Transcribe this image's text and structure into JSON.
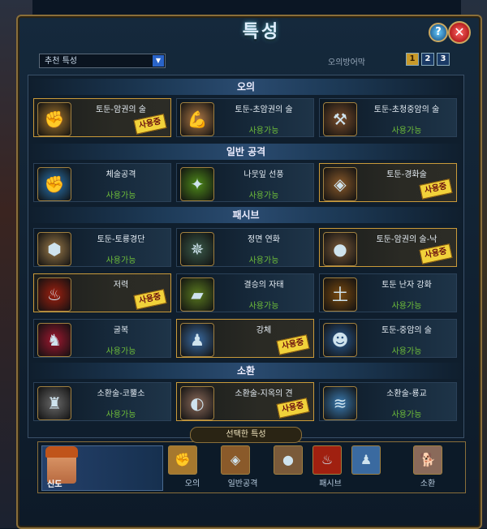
{
  "window": {
    "title": "특성"
  },
  "controls": {
    "help": "?",
    "close": "✕"
  },
  "dropdown": {
    "value": "추천 특성"
  },
  "mode_label": "오의방어막",
  "pages": [
    "1",
    "2",
    "3"
  ],
  "sections": {
    "oui": "오의",
    "general": "일반 공격",
    "passive": "패시브",
    "summon": "소환"
  },
  "cards": [
    {
      "name": "토둔-암권의 술",
      "status": "",
      "stamp": "사용중",
      "icon": "fist-icon",
      "color": "#a6782e"
    },
    {
      "name": "토둔-초암권의 술",
      "status": "사용가능",
      "stamp": "",
      "icon": "arm-icon",
      "color": "#b07a46"
    },
    {
      "name": "토둔-초청중암의 술",
      "status": "사용가능",
      "stamp": "",
      "icon": "hammer-icon",
      "color": "#7a4e2c"
    },
    {
      "name": "체술공격",
      "status": "사용가능",
      "stamp": "",
      "icon": "punch-icon",
      "color": "#2a7ab8"
    },
    {
      "name": "나뭇잎 선풍",
      "status": "사용가능",
      "stamp": "",
      "icon": "kick-icon",
      "color": "#4e8a1a"
    },
    {
      "name": "토둔-경화술",
      "status": "",
      "stamp": "사용중",
      "icon": "stone-shield-icon",
      "color": "#8a5a2a"
    },
    {
      "name": "토둔-토룡경단",
      "status": "사용가능",
      "stamp": "",
      "icon": "boulder-icon",
      "color": "#9a7a4a"
    },
    {
      "name": "정면 연화",
      "status": "사용가능",
      "stamp": "",
      "icon": "drill-icon",
      "color": "#3a5a4a"
    },
    {
      "name": "토둔-암권의 술-낙",
      "status": "",
      "stamp": "사용중",
      "icon": "rock-fist-icon",
      "color": "#7a5a3a"
    },
    {
      "name": "저력",
      "status": "",
      "stamp": "사용중",
      "icon": "red-aura-icon",
      "color": "#a02010"
    },
    {
      "name": "결승의 자태",
      "status": "사용가능",
      "stamp": "",
      "icon": "book-icon",
      "color": "#5a7a20"
    },
    {
      "name": "토둔 난자 강화",
      "status": "사용가능",
      "stamp": "",
      "icon": "earth-glyph-icon",
      "color": "#7a4a10"
    },
    {
      "name": "굴복",
      "status": "사용가능",
      "stamp": "",
      "icon": "kneel-icon",
      "color": "#a01830"
    },
    {
      "name": "강체",
      "status": "",
      "stamp": "사용중",
      "icon": "body-icon",
      "color": "#3a6aa0"
    },
    {
      "name": "토둔-중암의 술",
      "status": "사용가능",
      "stamp": "",
      "icon": "duo-icon",
      "color": "#2a5a90"
    },
    {
      "name": "소환술-코뿔소",
      "status": "사용가능",
      "stamp": "",
      "icon": "rhino-icon",
      "color": "#6a6a6a"
    },
    {
      "name": "소환술-지옥의 견",
      "status": "",
      "stamp": "사용중",
      "icon": "dog-icon",
      "color": "#8a6a5a"
    },
    {
      "name": "소환술-룡교",
      "status": "사용가능",
      "stamp": "",
      "icon": "dragon-icon",
      "color": "#3a7ab0"
    }
  ],
  "selected": {
    "header": "선택한 특성",
    "character": "신도",
    "groups": {
      "oui": "오의",
      "general": "일반공격",
      "passive": "패시브",
      "summon": "소환"
    }
  }
}
